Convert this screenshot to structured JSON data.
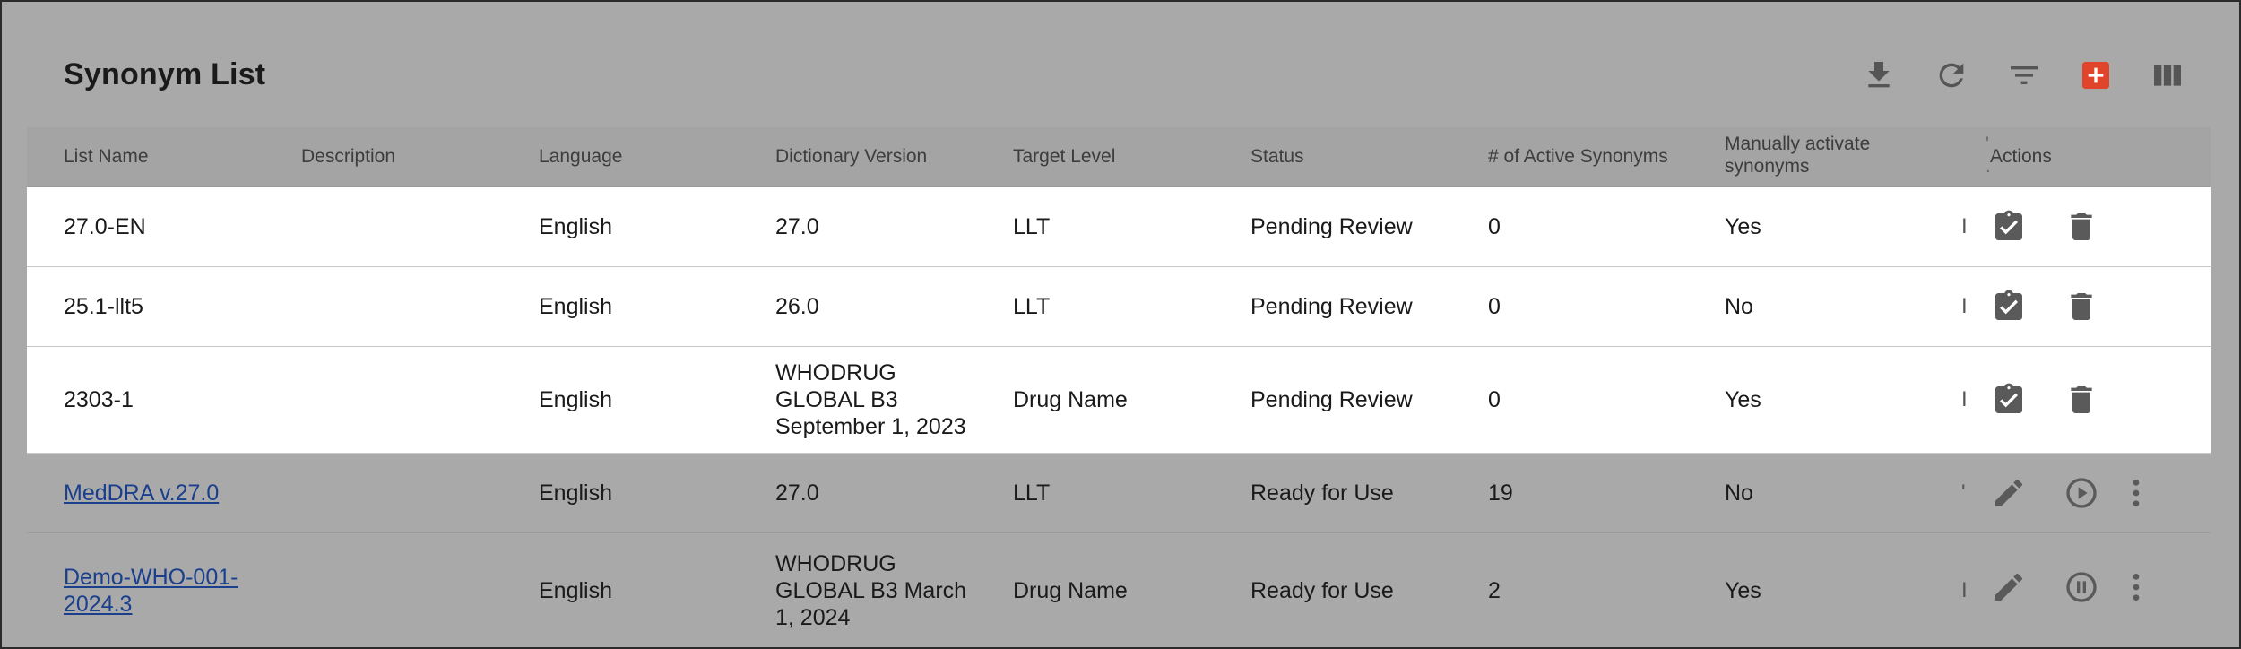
{
  "title": "Synonym List",
  "toolbar": {
    "icons": [
      "download-icon",
      "refresh-icon",
      "filter-icon",
      "add-icon",
      "columns-icon"
    ],
    "accent_color": "#e0452b"
  },
  "columns": {
    "list_name": "List Name",
    "description": "Description",
    "language": "Language",
    "dictionary_version": "Dictionary Version",
    "target_level": "Target Level",
    "status": "Status",
    "active_synonyms": "# of Active Synonyms",
    "manually_activate": "Manually activate synonyms",
    "actions": "Actions"
  },
  "rows": [
    {
      "list_name": "27.0-EN",
      "description": "",
      "language": "English",
      "dictionary_version": "27.0",
      "target_level": "LLT",
      "status": "Pending Review",
      "active_synonyms": "0",
      "manually_activate": "Yes",
      "clipped": "I"
    },
    {
      "list_name": "25.1-llt5",
      "description": "",
      "language": "English",
      "dictionary_version": "26.0",
      "target_level": "LLT",
      "status": "Pending Review",
      "active_synonyms": "0",
      "manually_activate": "No",
      "clipped": "I"
    },
    {
      "list_name": "2303-1",
      "description": "",
      "language": "English",
      "dictionary_version": "WHODRUG GLOBAL B3 September 1, 2023",
      "target_level": "Drug Name",
      "status": "Pending Review",
      "active_synonyms": "0",
      "manually_activate": "Yes",
      "clipped": "I"
    },
    {
      "list_name": "MedDRA v.27.0",
      "description": "",
      "language": "English",
      "dictionary_version": "27.0",
      "target_level": "LLT",
      "status": "Ready for Use",
      "active_synonyms": "19",
      "manually_activate": "No",
      "clipped": "'"
    },
    {
      "list_name": "Demo-WHO-001-2024.3",
      "description": "",
      "language": "English",
      "dictionary_version": "WHODRUG GLOBAL B3 March 1, 2024",
      "target_level": "Drug Name",
      "status": "Ready for Use",
      "active_synonyms": "2",
      "manually_activate": "Yes",
      "clipped": "I"
    }
  ]
}
